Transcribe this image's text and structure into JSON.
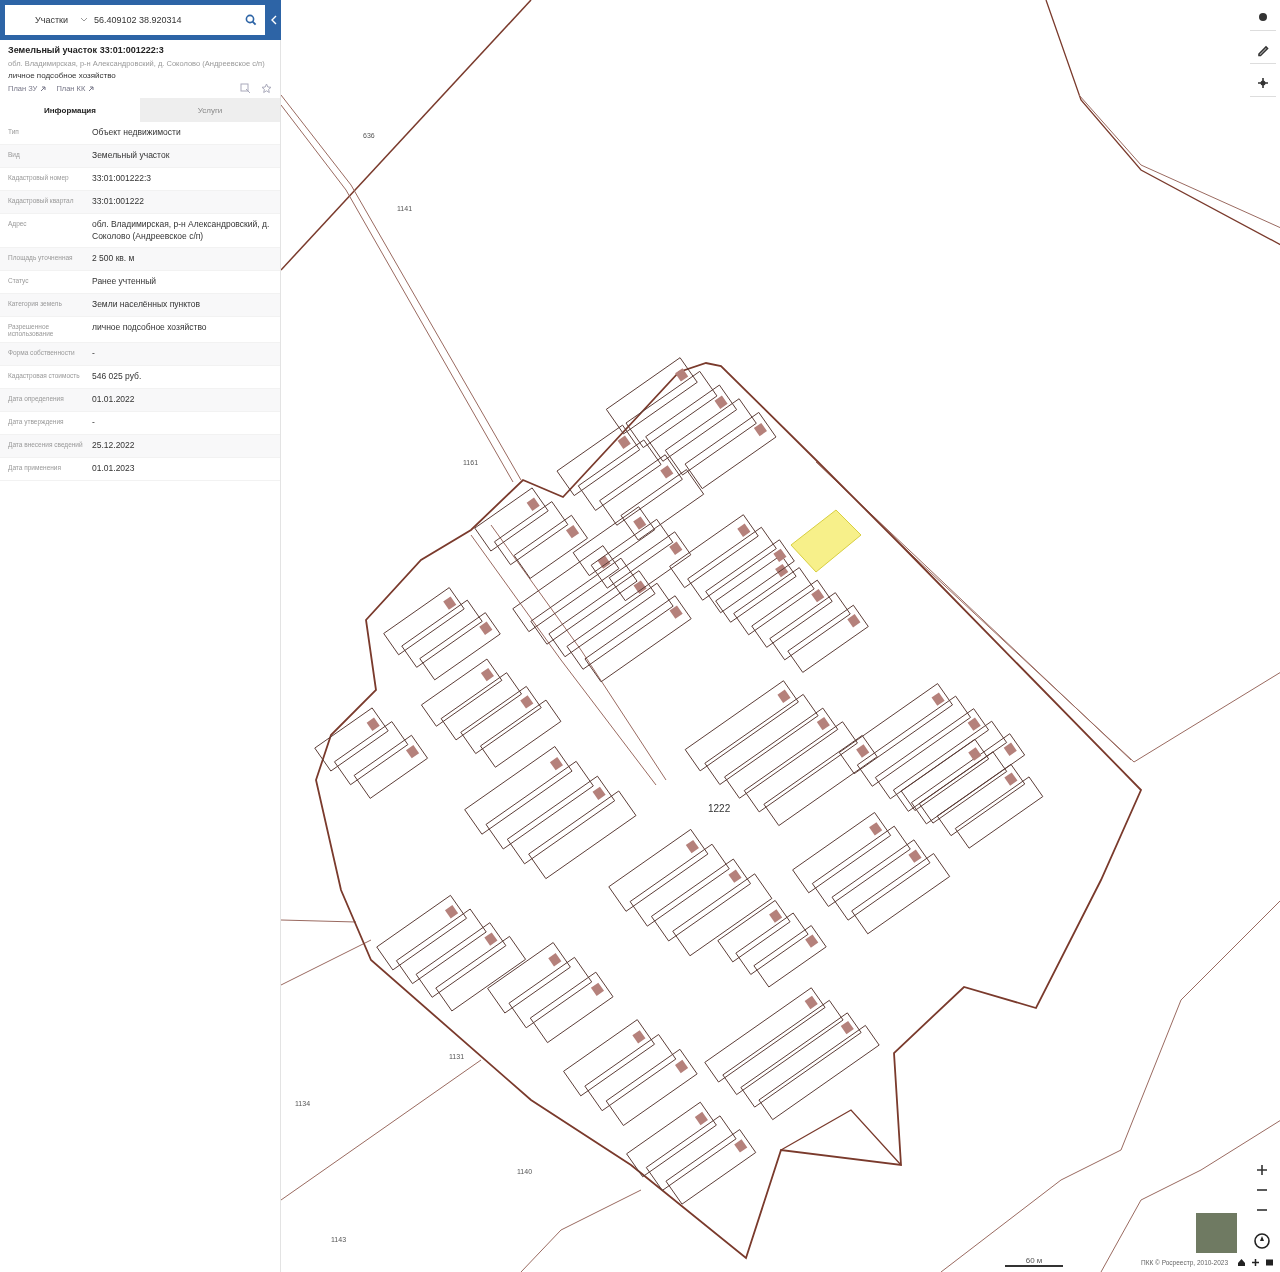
{
  "search": {
    "category": "Участки",
    "query": "56.409102 38.920314"
  },
  "card": {
    "title": "Земельный участок 33:01:001222:3",
    "address": "обл. Владимирская, р-н Александровский, д. Соколово (Андреевское с/п)",
    "usage": "личное подсобное хозяйство",
    "links": [
      "План ЗУ",
      "План КК"
    ]
  },
  "tabs": [
    {
      "label": "Информация",
      "selected": true
    },
    {
      "label": "Услуги",
      "selected": false
    }
  ],
  "info_rows": [
    {
      "label": "Тип",
      "value": "Объект недвижимости"
    },
    {
      "label": "Вид",
      "value": "Земельный участок"
    },
    {
      "label": "Кадастровый номер",
      "value": "33:01:001222:3"
    },
    {
      "label": "Кадастровый квартал",
      "value": "33:01:001222"
    },
    {
      "label": "Адрес",
      "value": "обл. Владимирская, р-н Александровский, д. Соколово (Андреевское с/п)"
    },
    {
      "label": "Площадь уточненная",
      "value": "2 500 кв. м"
    },
    {
      "label": "Статус",
      "value": "Ранее учтенный"
    },
    {
      "label": "Категория земель",
      "value": "Земли населённых пунктов"
    },
    {
      "label": "Разрешенное использование",
      "value": "личное подсобное хозяйство"
    },
    {
      "label": "Форма собственности",
      "value": "-"
    },
    {
      "label": "Кадастровая стоимость",
      "value": "546 025 руб."
    },
    {
      "label": "Дата определения",
      "value": "01.01.2022"
    },
    {
      "label": "Дата утверждения",
      "value": "-"
    },
    {
      "label": "Дата внесения сведений",
      "value": "25.12.2022"
    },
    {
      "label": "Дата применения",
      "value": "01.01.2023"
    }
  ],
  "map": {
    "labels": [
      "636",
      "1141",
      "1161",
      "1222",
      "1131",
      "1134",
      "1140",
      "1143"
    ],
    "scale": "60 м",
    "attribution": "ПКК © Росреестр, 2010-2023"
  }
}
